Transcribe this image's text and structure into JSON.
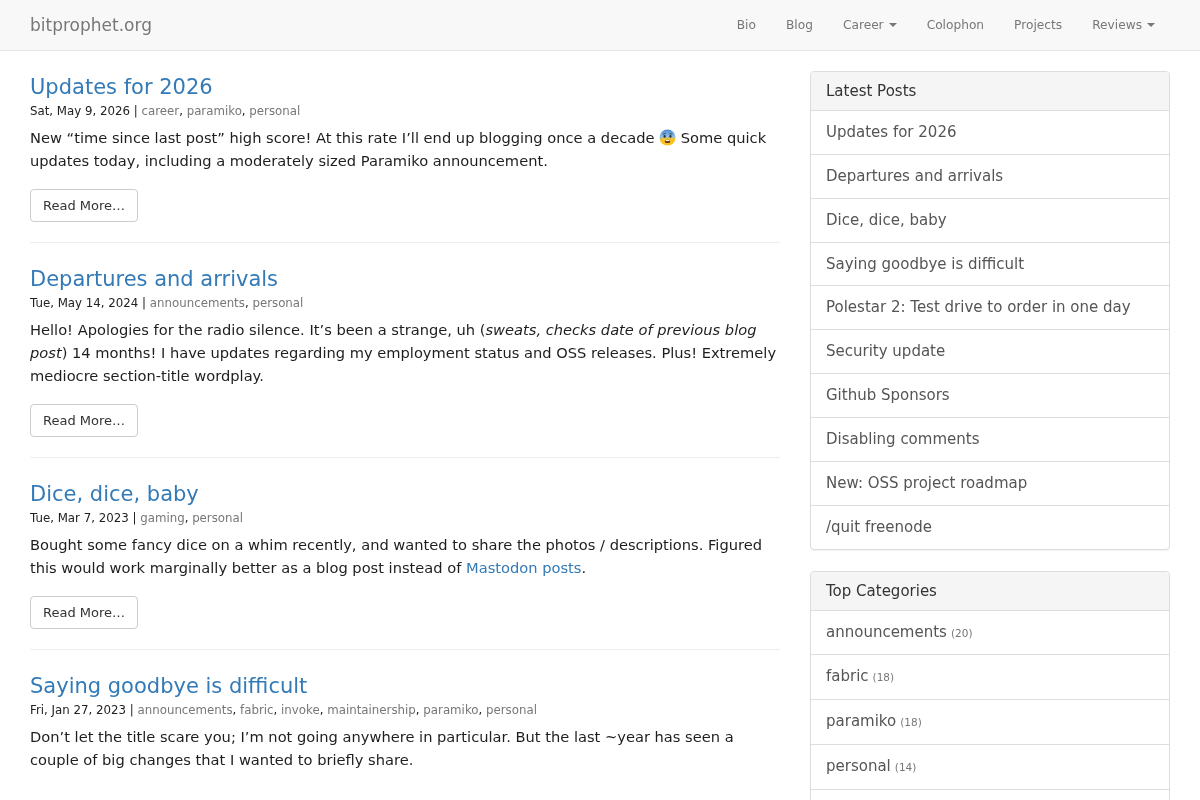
{
  "navbar": {
    "brand": "bitprophet.org",
    "items": [
      {
        "label": "Bio",
        "kind": "link"
      },
      {
        "label": "Blog",
        "kind": "link"
      },
      {
        "label": "Career",
        "kind": "dropdown"
      },
      {
        "label": "Colophon",
        "kind": "link"
      },
      {
        "label": "Projects",
        "kind": "link"
      },
      {
        "label": "Reviews",
        "kind": "dropdown"
      }
    ]
  },
  "posts": [
    {
      "title": "Updates for 2026",
      "meta": [
        {
          "kind": "text",
          "text": "Sat, May 9, 2026 | "
        },
        {
          "kind": "tag",
          "text": "career"
        },
        {
          "kind": "text",
          "text": ", "
        },
        {
          "kind": "tag",
          "text": "paramiko"
        },
        {
          "kind": "text",
          "text": ", "
        },
        {
          "kind": "tag",
          "text": "personal"
        }
      ],
      "excerpt": [
        {
          "kind": "text",
          "text": "New “time since last post” high score! At this rate I’ll end up blogging once a decade "
        },
        {
          "kind": "emoji"
        },
        {
          "kind": "text",
          "text": " Some quick updates today, including a moderately sized Paramiko announcement."
        }
      ],
      "read_more": "Read More…"
    },
    {
      "title": "Departures and arrivals",
      "meta": [
        {
          "kind": "text",
          "text": "Tue, May 14, 2024 | "
        },
        {
          "kind": "tag",
          "text": "announcements"
        },
        {
          "kind": "text",
          "text": ", "
        },
        {
          "kind": "tag",
          "text": "personal"
        }
      ],
      "excerpt": [
        {
          "kind": "text",
          "text": "Hello! Apologies for the radio silence. It’s been a strange, uh (*sweats, checks date of previous blog post*) 14 months! I have updates regarding my employment status and OSS releases. Plus! Extremely mediocre section-title wordplay."
        }
      ],
      "read_more": "Read More…"
    },
    {
      "title": "Dice, dice, baby",
      "meta": [
        {
          "kind": "text",
          "text": "Tue, Mar 7, 2023 | "
        },
        {
          "kind": "tag",
          "text": "gaming"
        },
        {
          "kind": "text",
          "text": ", "
        },
        {
          "kind": "tag",
          "text": "personal"
        }
      ],
      "excerpt": [
        {
          "kind": "text",
          "text": "Bought some fancy dice on a whim recently, and wanted to share the photos / descriptions. Figured this would work marginally better as a blog post instead of "
        },
        {
          "kind": "link",
          "text": "Mastodon posts"
        },
        {
          "kind": "text",
          "text": "."
        }
      ],
      "read_more": "Read More…"
    },
    {
      "title": "Saying goodbye is difficult",
      "meta": [
        {
          "kind": "text",
          "text": "Fri, Jan 27, 2023 | "
        },
        {
          "kind": "tag",
          "text": "announcements"
        },
        {
          "kind": "text",
          "text": ", "
        },
        {
          "kind": "tag",
          "text": "fabric"
        },
        {
          "kind": "text",
          "text": ", "
        },
        {
          "kind": "tag",
          "text": "invoke"
        },
        {
          "kind": "text",
          "text": ", "
        },
        {
          "kind": "tag",
          "text": "maintainership"
        },
        {
          "kind": "text",
          "text": ", "
        },
        {
          "kind": "tag",
          "text": "paramiko"
        },
        {
          "kind": "text",
          "text": ", "
        },
        {
          "kind": "tag",
          "text": "personal"
        }
      ],
      "excerpt": [
        {
          "kind": "text",
          "text": "Don’t let the title scare you; I’m not going anywhere in particular. But the last ~year has seen a couple of big changes that I wanted to briefly share."
        }
      ]
    }
  ],
  "sidebar": {
    "panels": [
      {
        "title": "Latest Posts",
        "items": [
          {
            "label": "Updates for 2026"
          },
          {
            "label": "Departures and arrivals"
          },
          {
            "label": "Dice, dice, baby"
          },
          {
            "label": "Saying goodbye is difficult"
          },
          {
            "label": "Polestar 2: Test drive to order in one day"
          },
          {
            "label": "Security update"
          },
          {
            "label": "Github Sponsors"
          },
          {
            "label": "Disabling comments"
          },
          {
            "label": "New: OSS project roadmap"
          },
          {
            "label": "/quit freenode"
          }
        ]
      },
      {
        "title": "Top Categories",
        "items": [
          {
            "label": "announcements",
            "count": "(20)"
          },
          {
            "label": "fabric",
            "count": "(18)"
          },
          {
            "label": "paramiko",
            "count": "(18)"
          },
          {
            "label": "personal",
            "count": "(14)"
          }
        ]
      }
    ]
  }
}
